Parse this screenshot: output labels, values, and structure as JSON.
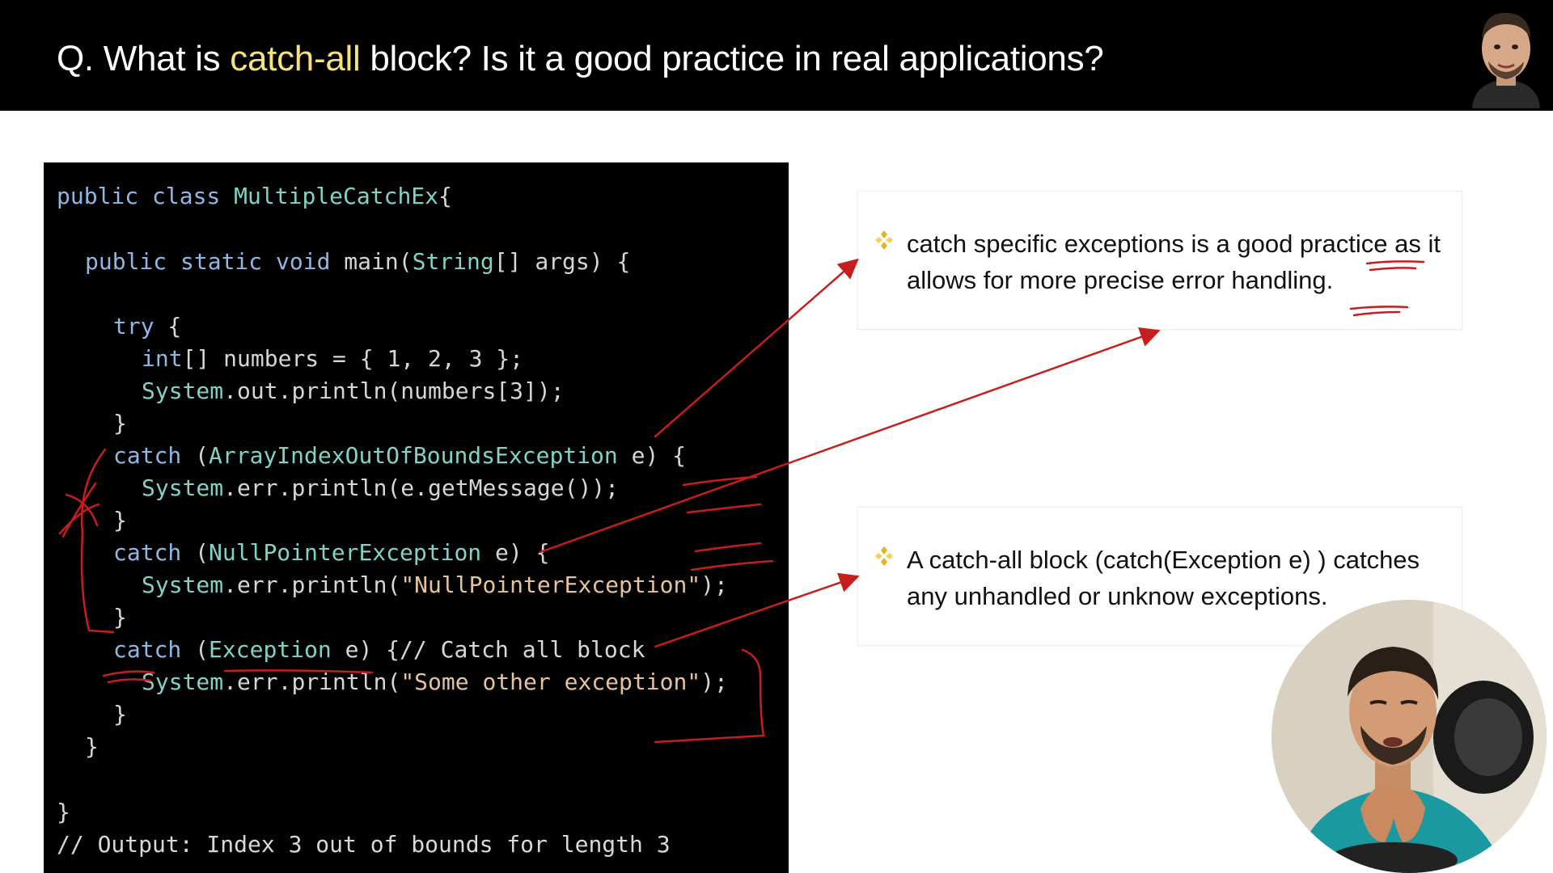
{
  "title": {
    "prefix": "Q. What is ",
    "highlight": "catch-all",
    "suffix": " block? Is it a good practice in real applications?"
  },
  "code": {
    "lines": [
      {
        "indent": 0,
        "parts": [
          [
            "kw",
            "public class "
          ],
          [
            "ty",
            "MultipleCatchEx"
          ],
          [
            "",
            "{"
          ]
        ]
      },
      {
        "indent": 2,
        "parts": [
          [
            "kw",
            "public static void "
          ],
          [
            "",
            "main("
          ],
          [
            "ty",
            "String"
          ],
          [
            "",
            "[] args) {"
          ]
        ]
      },
      {
        "indent": 4,
        "parts": [
          [
            "kw",
            "try"
          ],
          [
            "",
            " {"
          ]
        ]
      },
      {
        "indent": 6,
        "parts": [
          [
            "kw",
            "int"
          ],
          [
            "",
            "[] numbers = { 1, 2, 3 };"
          ]
        ]
      },
      {
        "indent": 6,
        "parts": [
          [
            "ty",
            "System"
          ],
          [
            "",
            ".out.println(numbers[3]);"
          ]
        ]
      },
      {
        "indent": 4,
        "parts": [
          [
            "",
            "}"
          ]
        ]
      },
      {
        "indent": 4,
        "parts": [
          [
            "kw",
            "catch"
          ],
          [
            "",
            " ("
          ],
          [
            "ty",
            "ArrayIndexOutOfBoundsException"
          ],
          [
            "",
            " e) {"
          ]
        ]
      },
      {
        "indent": 6,
        "parts": [
          [
            "ty",
            "System"
          ],
          [
            "",
            ".err.println(e.getMessage());"
          ]
        ]
      },
      {
        "indent": 4,
        "parts": [
          [
            "",
            "}"
          ]
        ]
      },
      {
        "indent": 4,
        "parts": [
          [
            "kw",
            "catch"
          ],
          [
            "",
            " ("
          ],
          [
            "ty",
            "NullPointerException"
          ],
          [
            "",
            " e) {"
          ]
        ]
      },
      {
        "indent": 6,
        "parts": [
          [
            "ty",
            "System"
          ],
          [
            "",
            ".err.println("
          ],
          [
            "str",
            "\"NullPointerException\""
          ],
          [
            "",
            ");"
          ]
        ]
      },
      {
        "indent": 4,
        "parts": [
          [
            "",
            "}"
          ]
        ]
      },
      {
        "indent": 4,
        "parts": [
          [
            "kw",
            "catch"
          ],
          [
            "",
            " ("
          ],
          [
            "ty",
            "Exception"
          ],
          [
            "",
            " e) {"
          ],
          [
            "cm",
            "// Catch all block"
          ]
        ]
      },
      {
        "indent": 6,
        "parts": [
          [
            "ty",
            "System"
          ],
          [
            "",
            ".err.println("
          ],
          [
            "str",
            "\"Some other exception\""
          ],
          [
            "",
            ");"
          ]
        ]
      },
      {
        "indent": 4,
        "parts": [
          [
            "",
            "}"
          ]
        ]
      },
      {
        "indent": 2,
        "parts": [
          [
            "",
            "}"
          ]
        ]
      },
      {
        "indent": 0,
        "parts": [
          [
            "",
            "}"
          ]
        ]
      },
      {
        "indent": 0,
        "parts": [
          [
            "cm",
            "// Output: Index 3 out of bounds for length 3"
          ]
        ]
      }
    ]
  },
  "cards": [
    {
      "text": "catch specific exceptions is a good practice as it allows for more precise error handling."
    },
    {
      "text": "A catch-all block (catch(Exception e) ) catches any unhandled or unknow exceptions."
    }
  ],
  "colors": {
    "highlight": "#f6e27a",
    "bullet": "#e3b51e",
    "annotation": "#c81d1d",
    "title_bg": "#000000",
    "code_bg": "#000000"
  },
  "icons": {
    "bullet": "four-diamond-bullet-icon",
    "presenter_thumb": "presenter-avatar-icon",
    "webcam": "presenter-webcam"
  }
}
